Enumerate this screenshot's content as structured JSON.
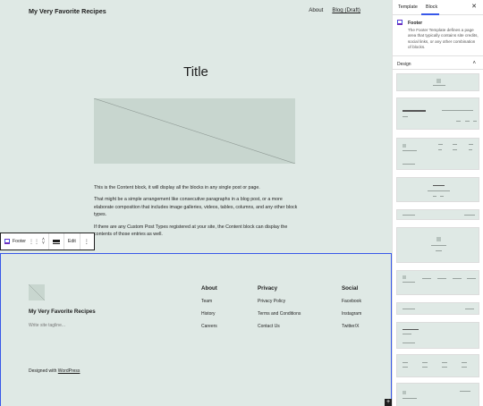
{
  "header": {
    "site_title": "My Very Favorite Recipes",
    "nav": [
      {
        "label": "About"
      },
      {
        "label": "Blog (Draft)"
      }
    ]
  },
  "post": {
    "title": "Title",
    "paragraphs": [
      "This is the Content block, it will display all the blocks in any single post or page.",
      "That might be a simple arrangement like consecutive paragraphs in a blog post, or a more elaborate composition that includes image galleries, videos, tables, columns, and any other block types.",
      "If there are any Custom Post Types registered at your site, the Content block can display the contents of those entries as well."
    ]
  },
  "toolbar": {
    "block_label": "Footer",
    "edit_label": "Edit",
    "more_icon": "vertical-dots-icon",
    "drag_icon": "drag-handle-icon",
    "move_icon": "chevron-up-down-icon",
    "align_icon": "align-icon"
  },
  "footer": {
    "site_title": "My Very Favorite Recipes",
    "tagline": "Write site tagline...",
    "columns": [
      {
        "heading": "About",
        "items": [
          "Team",
          "History",
          "Careers"
        ]
      },
      {
        "heading": "Privacy",
        "items": [
          "Privacy Policy",
          "Terms and Conditions",
          "Contact Us"
        ]
      },
      {
        "heading": "Social",
        "items": [
          "Facebook",
          "Instagram",
          "Twitter/X"
        ]
      }
    ],
    "designed_prefix": "Designed with",
    "designed_link": "WordPress"
  },
  "sidebar": {
    "tabs": [
      {
        "label": "Template"
      },
      {
        "label": "Block"
      }
    ],
    "active_tab": "Block",
    "close_icon": "close-icon",
    "block_card": {
      "name": "Footer",
      "description": "The Footer Template defines a page area that typically contains site credits, social links, or any other combination of blocks."
    },
    "design_label": "Design",
    "design_expanded": true
  },
  "colors": {
    "canvas_bg": "#dfe9e5",
    "accent": "#3858e9",
    "block_icon": "#6b2fbf",
    "text": "#1e1e1e"
  }
}
